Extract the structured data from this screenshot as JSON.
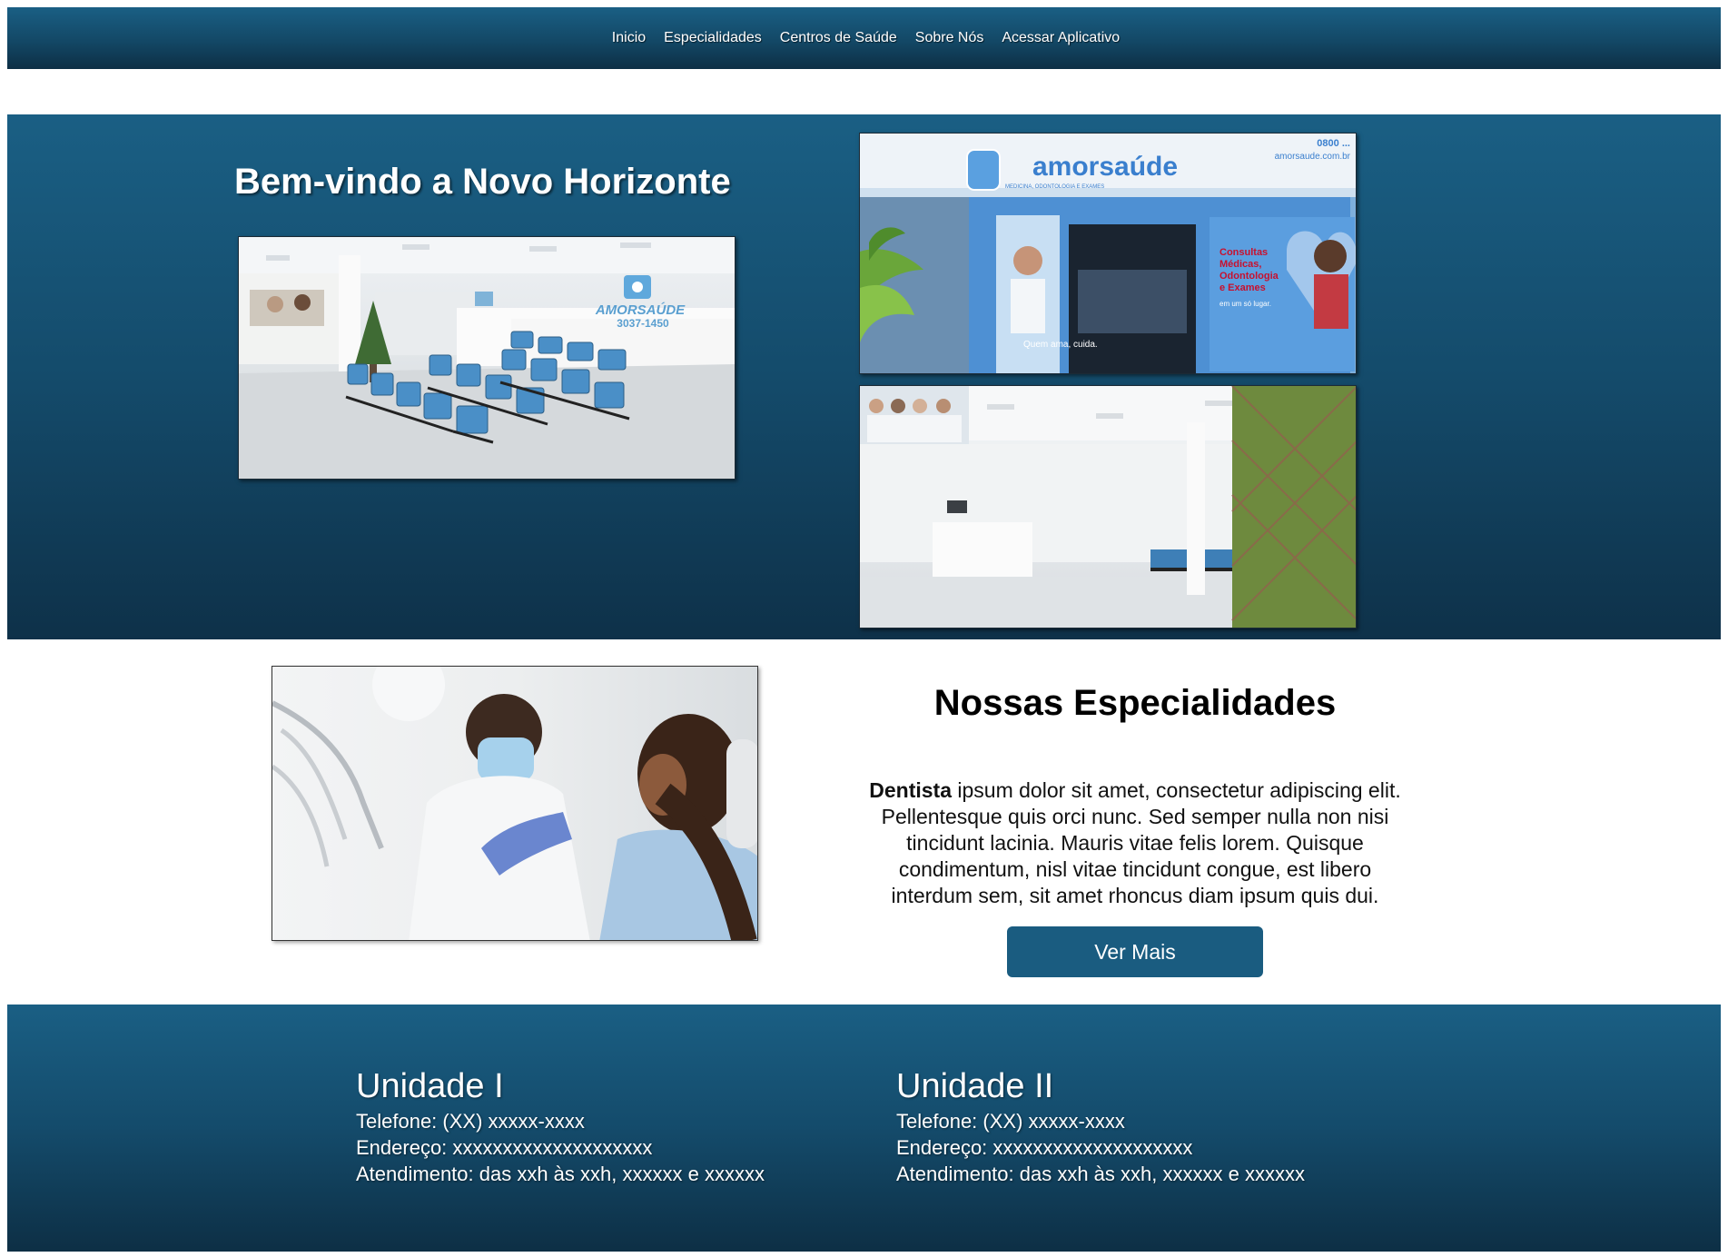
{
  "nav": {
    "items": [
      "Inicio",
      "Especialidades",
      "Centros de Saúde",
      "Sobre Nós",
      "Acessar Aplicativo"
    ]
  },
  "hero": {
    "title": "Bem-vindo a Novo Horizonte",
    "photos": {
      "waiting_room_sign": "AMORSAÚDE",
      "waiting_room_phone": "3037-1450",
      "storefront_brand": "amorsaúde",
      "storefront_sub": "MEDICINA, ODONTOLOGIA E EXAMES",
      "storefront_phone": "0800 ...",
      "storefront_site": "amorsaude.com.br",
      "storefront_panel": "Consultas Médicas, Odontologia e Exames",
      "storefront_panel_sub": "em um só lugar.",
      "storefront_door": "Quem ama, cuida."
    }
  },
  "specialties": {
    "title": "Nossas Especialidades",
    "lead": "Dentista",
    "text": " ipsum dolor sit amet, consectetur adipiscing elit. Pellentesque quis orci nunc. Sed semper nulla non nisi tincidunt lacinia. Mauris vitae felis lorem. Quisque condimentum, nisl vitae tincidunt congue, est libero interdum sem, sit amet rhoncus diam ipsum quis dui.",
    "button": "Ver Mais"
  },
  "footer": {
    "units": [
      {
        "name": "Unidade I",
        "phone": "Telefone: (XX) xxxxx-xxxx",
        "address": "Endereço: xxxxxxxxxxxxxxxxxxxx",
        "hours": "Atendimento: das xxh às xxh, xxxxxx e xxxxxx"
      },
      {
        "name": "Unidade II",
        "phone": "Telefone: (XX) xxxxx-xxxx",
        "address": "Endereço: xxxxxxxxxxxxxxxxxxxx",
        "hours": "Atendimento: das xxh às xxh, xxxxxx e xxxxxx"
      }
    ]
  },
  "colors": {
    "brand_blue": "#1a5f84",
    "brand_dark": "#0d2f45",
    "button": "#1a5c80"
  }
}
